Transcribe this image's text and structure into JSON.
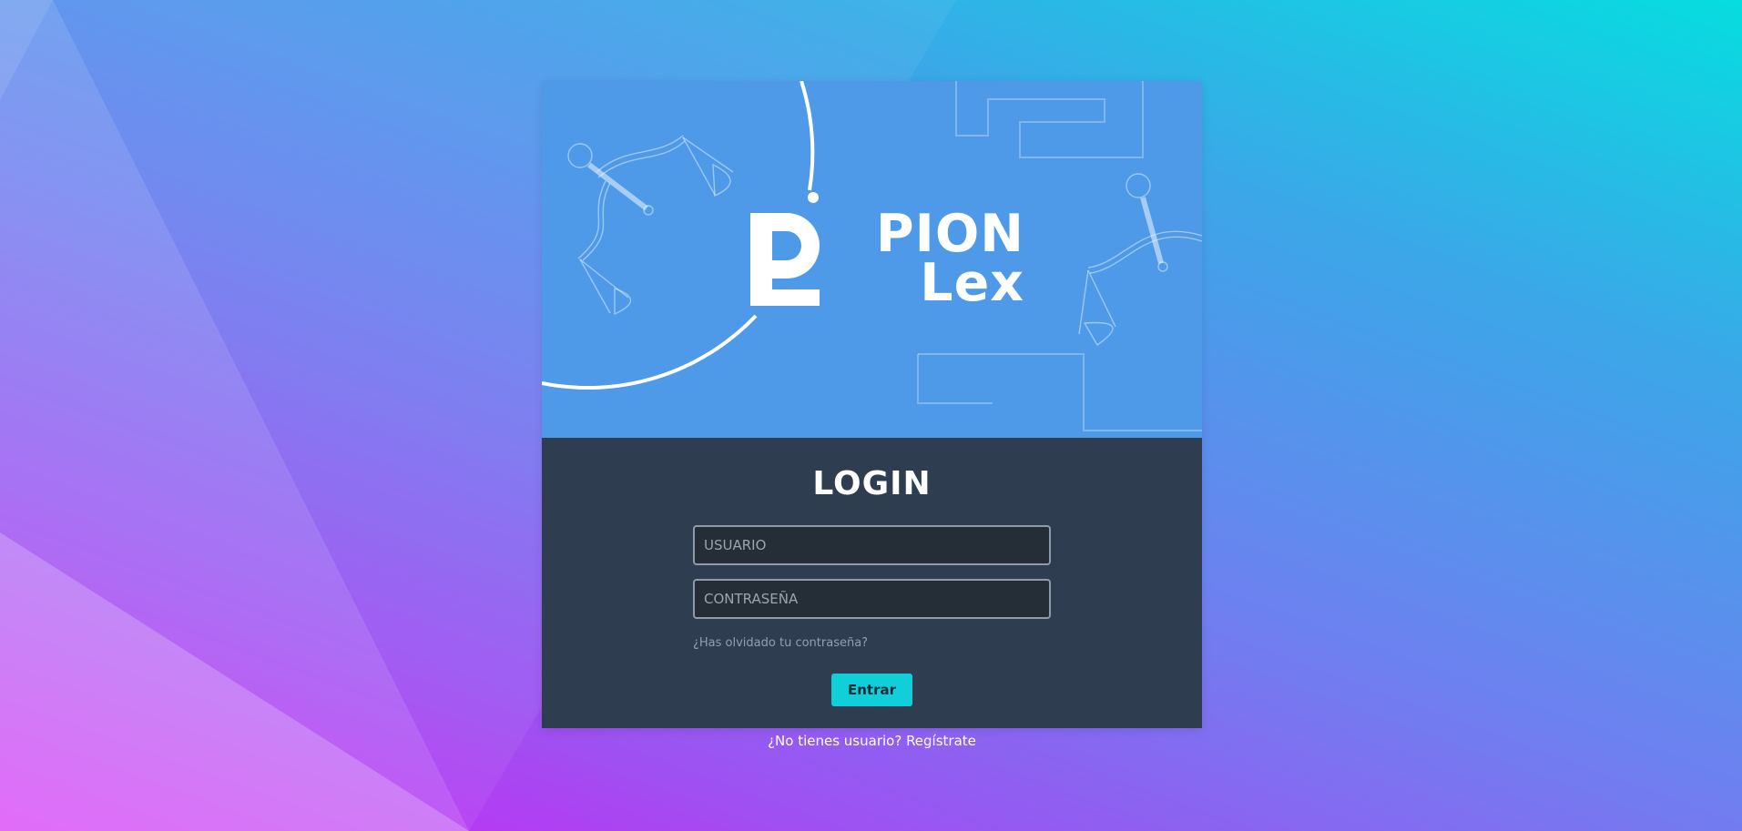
{
  "brand": {
    "line1": "PION",
    "line2": "Lex"
  },
  "login": {
    "title": "LOGIN",
    "username_placeholder": "USUARIO",
    "password_placeholder": "CONTRASEÑA",
    "forgot_label": "¿Has olvidado tu contraseña?",
    "submit_label": "Entrar",
    "register_label": "¿No tienes usuario? Regístrate"
  },
  "icons": {
    "logo": "pionlex-logo-icon",
    "scales_left": "scales-of-justice-icon",
    "scales_right": "scales-of-justice-icon"
  },
  "colors": {
    "hero_bg": "#4e9ae8",
    "panel_bg": "#2e3d50",
    "input_bg": "#252e37",
    "button_bg": "#10cfd9",
    "text": "#ffffff"
  }
}
